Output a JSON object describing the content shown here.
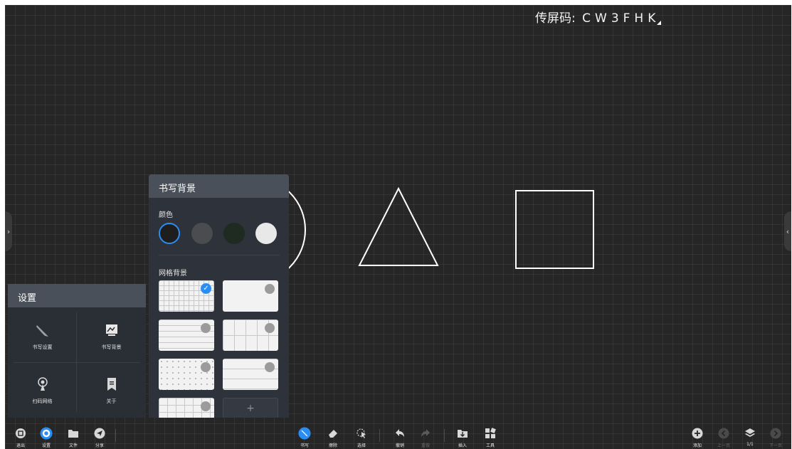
{
  "share_code": {
    "label": "传屏码:",
    "code": "CW3FHK"
  },
  "writing_background": {
    "title": "书写背景",
    "color_label": "颜色",
    "colors": [
      "#1e1e1e",
      "#4a4c50",
      "#1f2a20",
      "#e8e8e8"
    ],
    "grid_label": "网格背景",
    "add_label": "+"
  },
  "settings": {
    "title": "设置",
    "items": [
      {
        "label": "书写设置",
        "icon": "pen-settings-icon"
      },
      {
        "label": "书写背景",
        "icon": "writing-background-icon"
      },
      {
        "label": "扫码网络",
        "icon": "scan-network-icon"
      },
      {
        "label": "关于",
        "icon": "about-bookmark-icon"
      }
    ]
  },
  "toolbar": {
    "exit": "退出",
    "settings": "设置",
    "file": "文件",
    "share": "分享",
    "write": "书写",
    "erase": "擦除",
    "select": "选择",
    "undo": "撤销",
    "redo": "重做",
    "insert": "插入",
    "tools": "工具",
    "add": "添加",
    "prev": "上一页",
    "page": "1/1",
    "next": "下一页"
  },
  "accent_color": "#2a8df3"
}
